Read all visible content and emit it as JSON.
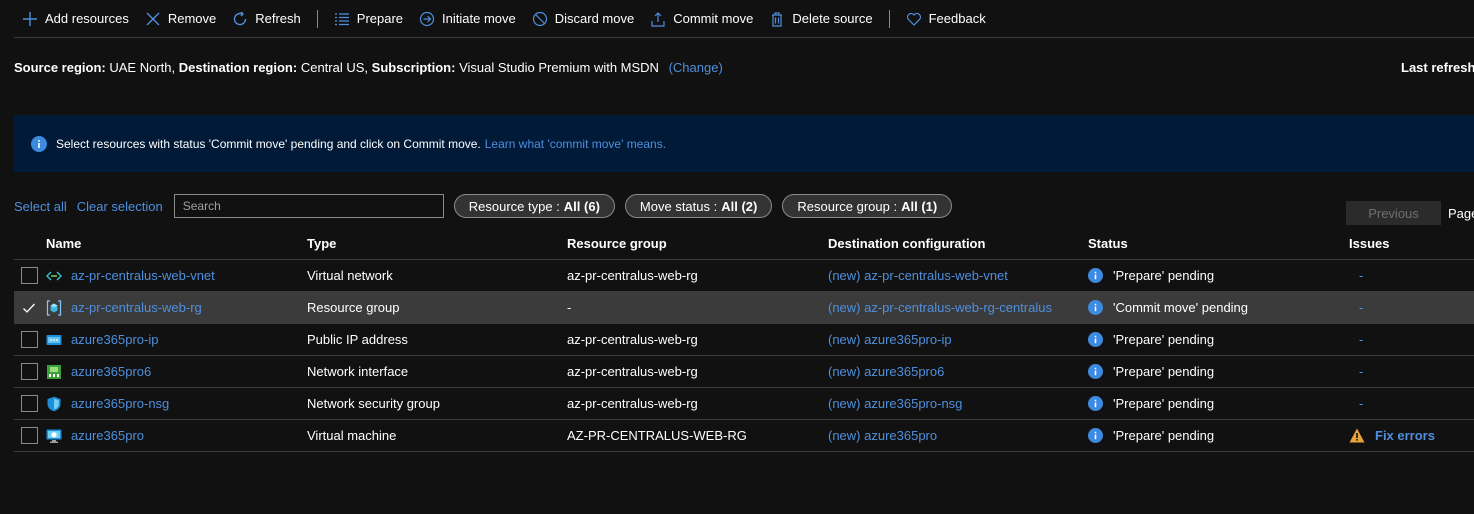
{
  "toolbar": {
    "add": "Add resources",
    "remove": "Remove",
    "refresh": "Refresh",
    "prepare": "Prepare",
    "initiate": "Initiate move",
    "discard": "Discard move",
    "commit": "Commit move",
    "delete_source": "Delete source",
    "feedback": "Feedback"
  },
  "region": {
    "source_label": "Source region:",
    "source_value": "UAE North,",
    "dest_label": "Destination region:",
    "dest_value": "Central US,",
    "sub_label": "Subscription:",
    "sub_value": "Visual Studio Premium with MSDN",
    "change": "(Change)",
    "last_refreshed": "Last refreshed"
  },
  "banner": {
    "text": "Select resources with status 'Commit move' pending and click on Commit move.",
    "link": "Learn what 'commit move' means."
  },
  "filters": {
    "select_all": "Select all",
    "clear": "Clear selection",
    "search_placeholder": "Search",
    "resource_type_label": "Resource type :",
    "resource_type_value": "All (6)",
    "move_status_label": "Move status :",
    "move_status_value": "All (2)",
    "resource_group_label": "Resource group :",
    "resource_group_value": "All (1)",
    "previous": "Previous",
    "page": "Page"
  },
  "table": {
    "headers": {
      "name": "Name",
      "type": "Type",
      "rg": "Resource group",
      "dest": "Destination configuration",
      "status": "Status",
      "issues": "Issues"
    },
    "rows": [
      {
        "name": "az-pr-centralus-web-vnet",
        "type": "Virtual network",
        "rg": "az-pr-centralus-web-rg",
        "dest": "(new) az-pr-centralus-web-vnet",
        "status": "'Prepare' pending",
        "issues": "-",
        "icon": "vnet-icon"
      },
      {
        "name": "az-pr-centralus-web-rg",
        "type": "Resource group",
        "rg": "-",
        "dest": "(new) az-pr-centralus-web-rg-centralus",
        "status": "'Commit move' pending",
        "issues": "-",
        "icon": "resource-group-icon"
      },
      {
        "name": "azure365pro-ip",
        "type": "Public IP address",
        "rg": "az-pr-centralus-web-rg",
        "dest": "(new) azure365pro-ip",
        "status": "'Prepare' pending",
        "issues": "-",
        "icon": "public-ip-icon"
      },
      {
        "name": "azure365pro6",
        "type": "Network interface",
        "rg": "az-pr-centralus-web-rg",
        "dest": "(new) azure365pro6",
        "status": "'Prepare' pending",
        "issues": "-",
        "icon": "network-interface-icon"
      },
      {
        "name": "azure365pro-nsg",
        "type": "Network security group",
        "rg": "az-pr-centralus-web-rg",
        "dest": "(new) azure365pro-nsg",
        "status": "'Prepare' pending",
        "issues": "-",
        "icon": "nsg-shield-icon"
      },
      {
        "name": "azure365pro",
        "type": "Virtual machine",
        "rg": "AZ-PR-CENTRALUS-WEB-RG",
        "dest": "(new) azure365pro",
        "status": "'Prepare' pending",
        "issues": "Fix errors",
        "icon": "virtual-machine-icon"
      }
    ]
  },
  "colors": {
    "background": "#111111",
    "link": "#4f8fdd",
    "banner": "#001a37",
    "selected_row": "#3b3b3b",
    "info": "#0f6cbd",
    "warning": "#e9a23b"
  }
}
